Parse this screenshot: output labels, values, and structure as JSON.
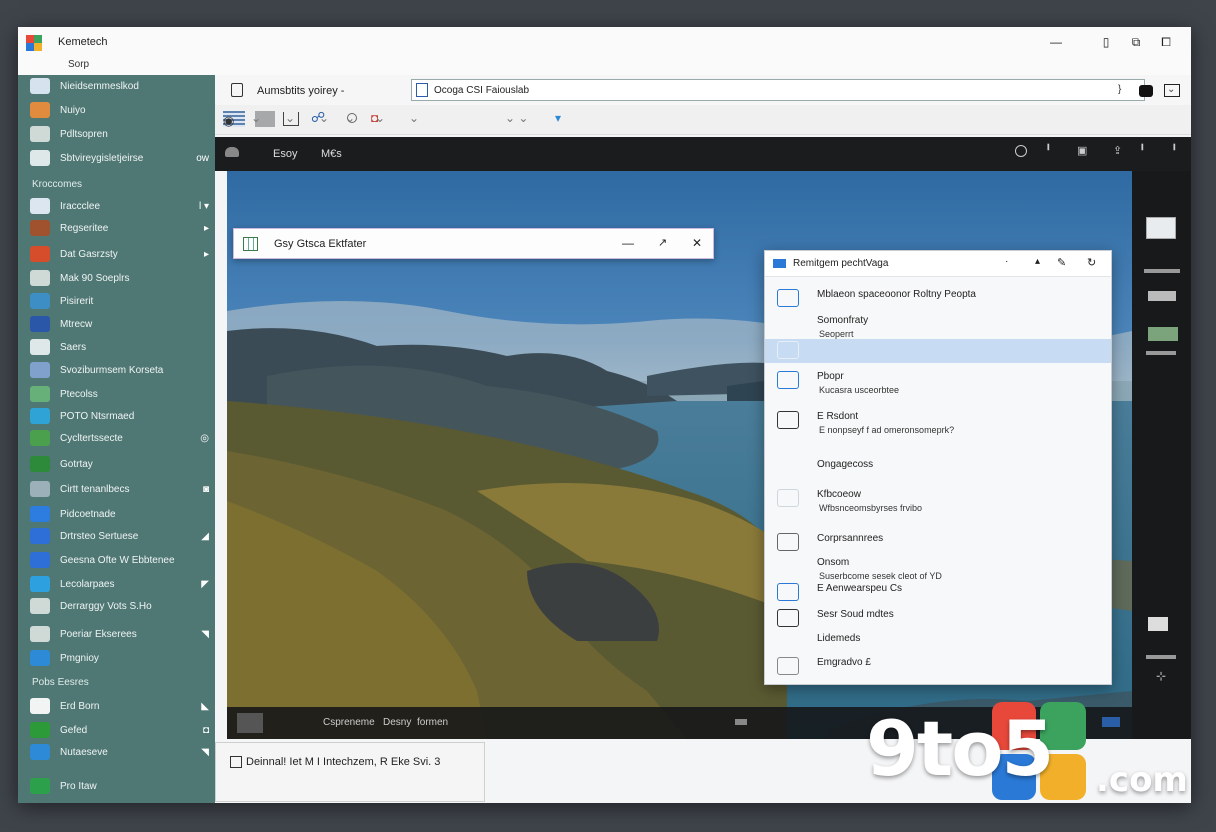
{
  "app": {
    "title": "Kemetech",
    "subtitle": "Sorp"
  },
  "titlebar_controls": [
    "—",
    "▯",
    "⧉",
    "⧠"
  ],
  "tab": {
    "label": "Aumsbtits yoirey -"
  },
  "url": {
    "value": "Ocoga CSI Faiouslab",
    "end_mark": "}"
  },
  "toolbar_icons": [
    "grid-icon",
    "tile-icon",
    "folder-icon",
    "users-icon",
    "clock-icon",
    "camera-icon"
  ],
  "nav": {
    "items": [
      "Esoy",
      "M€s"
    ]
  },
  "sidebar": {
    "items": [
      {
        "label": "Nieidsemmeslkod",
        "color": "#d6e3ee"
      },
      {
        "label": "Nuiyo",
        "color": "#e08b3e"
      },
      {
        "label": "Pdltsopren",
        "color": "#cfd9d6"
      },
      {
        "label": "Sbtvireygisletjeirse",
        "color": "#dfe8e8",
        "right": "ow"
      },
      {
        "label": "Kroccomes",
        "color": "",
        "header": true
      },
      {
        "label": "Iraccclee",
        "color": "#dbe6f0",
        "right": "l ▾"
      },
      {
        "label": "Regseritee",
        "color": "#a0512d",
        "right": "▸"
      },
      {
        "label": "Dat Gasrzsty",
        "color": "#d64d2b",
        "right": "▸"
      },
      {
        "label": "Mak 90 Soeplrs",
        "color": "#cfd9d6"
      },
      {
        "label": "Pisirerit",
        "color": "#3c8ec4"
      },
      {
        "label": "Mtrecw",
        "color": "#2b57a8"
      },
      {
        "label": "Saers",
        "color": "#dfe8e8"
      },
      {
        "label": "Svoziburmsem Korseta",
        "color": "#7fa1cc"
      },
      {
        "label": "Ptecolss",
        "color": "#68b07a"
      },
      {
        "label": "POTO Ntsrmaed",
        "color": "#2fa2d6"
      },
      {
        "label": "Cycltertssecte",
        "color": "#4aa04c",
        "right": "◎"
      },
      {
        "label": "Gotrtay",
        "color": "#2d8a3a"
      },
      {
        "label": "Cirtt tenanlbecs",
        "color": "#9bb0b8",
        "right": "◙"
      },
      {
        "label": "Pidcoetnade",
        "color": "#2d7de0"
      },
      {
        "label": "Drtrsteo Sertuese",
        "color": "#2d6fd6",
        "right": "◢"
      },
      {
        "label": "Geesna Ofte W Ebbtenee",
        "color": "#2d6fd6"
      },
      {
        "label": "Lecolarpaes",
        "color": "#2da0e0",
        "right": "◤"
      },
      {
        "label": "Derrarggy Vots S.Ho",
        "color": "#cfd9d6"
      },
      {
        "label": "Poeriar Ekserees",
        "color": "#cfd9d6",
        "right": "◥"
      },
      {
        "label": "Pmgnioy",
        "color": "#2d8ad6"
      },
      {
        "label": "Pobs Eesres",
        "color": "",
        "header": true
      },
      {
        "label": "Erd Born",
        "color": "#f2f4f4",
        "right": "◣"
      },
      {
        "label": "Gefed",
        "color": "#2d9a3a",
        "right": "◘"
      },
      {
        "label": "Nutaeseve",
        "color": "#2d8ad6",
        "right": "◥"
      },
      {
        "label": "Pro Itaw",
        "color": "#2da04c"
      }
    ]
  },
  "dialog": {
    "title": "Gsy Gtsca Ektfater",
    "controls": [
      "—",
      "↗",
      "✕"
    ]
  },
  "popup": {
    "title": "Remitgem pechtVaga",
    "items": [
      {
        "title": "Mblaeon spaceoonor Roltny Peopta",
        "sub": ""
      },
      {
        "title": "Somonfraty",
        "sub": "Seoperrt"
      },
      {
        "title": "",
        "sub": ""
      },
      {
        "title": "Pbopr",
        "sub": "Kucasra usceorbtee"
      },
      {
        "title": "E Rsdont",
        "sub": "E nonpseyf f ad omeronsomeprk?"
      },
      {
        "title": "Ongagecoss",
        "sub": ""
      },
      {
        "title": "Kfbcoeow",
        "sub": "Wfbsnceomsbyrses frvibo"
      },
      {
        "title": "Corprsannrees",
        "sub": ""
      },
      {
        "title": "Onsom",
        "sub": "Suserbcome sesek cleot of YD"
      },
      {
        "title": "E Aenwearspeu Cs",
        "sub": ""
      },
      {
        "title": "Sesr Soud mdtes",
        "sub": ""
      },
      {
        "title": "Lidemeds",
        "sub": ""
      },
      {
        "title": "Emgradvo £",
        "sub": ""
      }
    ]
  },
  "bottom": {
    "labels": [
      "Cspreneme",
      "Desny",
      "formen"
    ]
  },
  "status": {
    "text": "Deinnal! Iet M I Intechzem, R Eke Svi. 3"
  },
  "brand": {
    "text": "9to5",
    "suffix": ".com",
    "colors": [
      "#e8483a",
      "#3ba35d",
      "#2a79d6",
      "#f2b02a"
    ]
  }
}
